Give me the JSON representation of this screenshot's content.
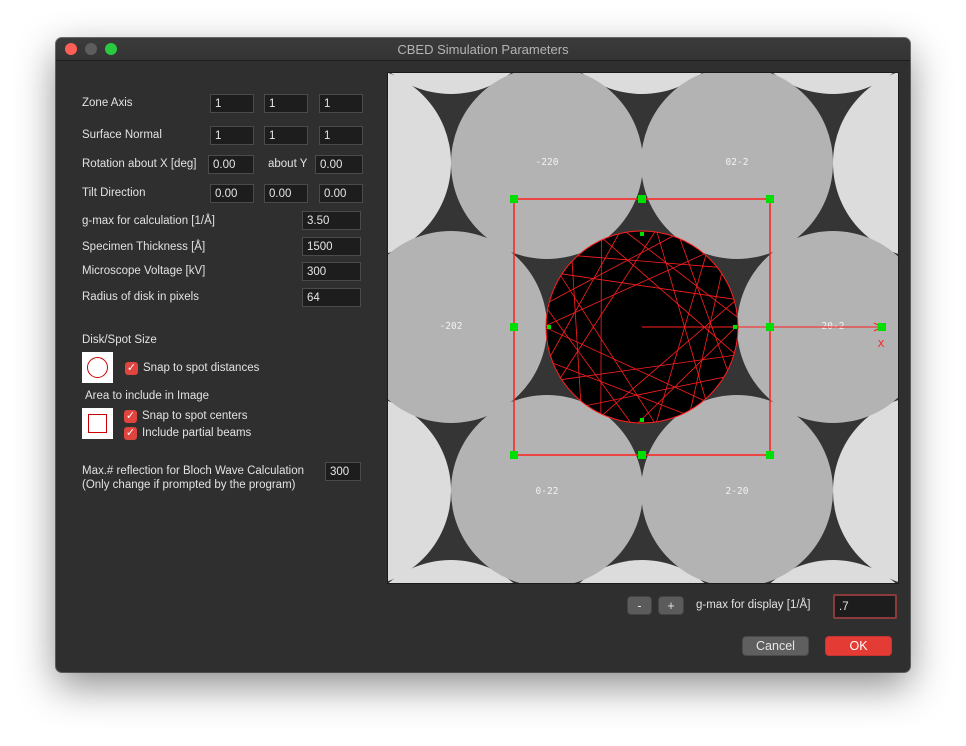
{
  "window": {
    "title": "CBED Simulation Parameters"
  },
  "form": {
    "zone_axis": {
      "label": "Zone Axis",
      "values": [
        "1",
        "1",
        "1"
      ]
    },
    "surface_normal": {
      "label": "Surface Normal",
      "values": [
        "1",
        "1",
        "1"
      ]
    },
    "rotation": {
      "label": "Rotation about X [deg]",
      "x": "0.00",
      "about_y_label": "about Y",
      "y": "0.00"
    },
    "tilt_direction": {
      "label": "Tilt Direction",
      "values": [
        "0.00",
        "0.00",
        "0.00"
      ]
    },
    "gmax_calc": {
      "label": "g-max for calculation [1/Å]",
      "value": "3.50"
    },
    "thickness": {
      "label": "Specimen Thickness [Å]",
      "value": "1500"
    },
    "voltage": {
      "label": "Microscope Voltage [kV]",
      "value": "300"
    },
    "disk_radius": {
      "label": "Radius of disk in pixels",
      "value": "64"
    },
    "disk_spot": {
      "heading": "Disk/Spot Size",
      "snap_label": "Snap to spot distances",
      "snap_checked": true
    },
    "area": {
      "heading": "Area to include in Image",
      "snap_centers_label": "Snap to spot centers",
      "snap_centers_checked": true,
      "partial_beams_label": "Include partial beams",
      "partial_beams_checked": true
    },
    "bloch": {
      "label_line1": "Max.# reflection for Bloch Wave Calculation",
      "label_line2": "(Only change if prompted by the program)",
      "value": "300"
    }
  },
  "pattern": {
    "disk_labels": [
      "-220",
      "02-2",
      "-202",
      "20-2",
      "0-22",
      "2-20"
    ],
    "axis_label": "X",
    "colors": {
      "background": "#dcdcdc",
      "gap": "#353535",
      "disk": "#b3b3b3",
      "center_disk": "#000000",
      "selection": "#ff1e1e",
      "handle": "#00e000"
    }
  },
  "bottom": {
    "minus_label": "-",
    "plus_label": "+",
    "gmax_display_label": "g-max for display [1/Å]",
    "gmax_display_value": ".7",
    "cancel_label": "Cancel",
    "ok_label": "OK"
  },
  "icons": {
    "close": "close-traffic-light-icon",
    "minimize": "minimize-traffic-light-icon",
    "maximize": "maximize-traffic-light-icon",
    "disk_preview": "circle-preview-icon",
    "area_preview": "square-preview-icon",
    "checkmark": "checkmark-icon"
  }
}
